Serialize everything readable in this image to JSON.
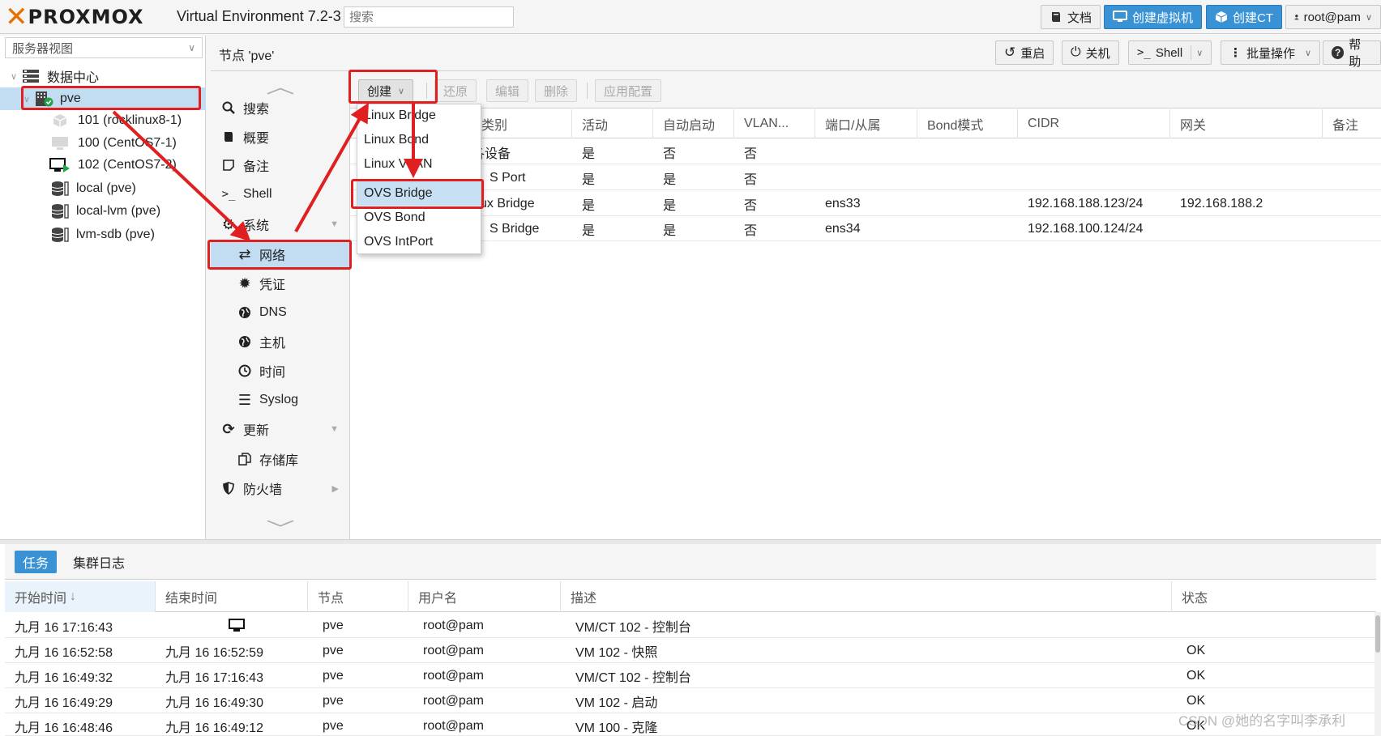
{
  "app": {
    "brand": "PROXMOX",
    "version": "Virtual Environment 7.2-3",
    "search_placeholder": "搜索"
  },
  "topbar": {
    "docs": "文档",
    "create_vm": "创建虚拟机",
    "create_ct": "创建CT",
    "user": "root@pam"
  },
  "tree": {
    "view": "服务器视图",
    "items": [
      {
        "label": "数据中心",
        "icon": "datacenter-icon"
      },
      {
        "label": "pve",
        "icon": "node-online-icon"
      },
      {
        "label": "101 (rocklinux8-1)",
        "icon": "container-icon"
      },
      {
        "label": "100 (CentOS7-1)",
        "icon": "vm-stopped-icon"
      },
      {
        "label": "102 (CentOS7-2)",
        "icon": "vm-running-icon"
      },
      {
        "label": "local (pve)",
        "icon": "storage-icon"
      },
      {
        "label": "local-lvm (pve)",
        "icon": "storage-icon"
      },
      {
        "label": "lvm-sdb (pve)",
        "icon": "storage-icon"
      }
    ]
  },
  "node": {
    "title": "节点 'pve'",
    "reboot": "重启",
    "shutdown": "关机",
    "shell": "Shell",
    "bulk": "批量操作",
    "help": "帮助"
  },
  "nodemenu": {
    "search": "搜索",
    "summary": "概要",
    "notes": "备注",
    "shell": "Shell",
    "system": "系统",
    "network": "网络",
    "certificates": "凭证",
    "dns": "DNS",
    "hosts": "主机",
    "time": "时间",
    "syslog": "Syslog",
    "updates": "更新",
    "repositories": "存储库",
    "firewall": "防火墙"
  },
  "network": {
    "toolbar": {
      "create": "创建",
      "revert": "还原",
      "edit": "编辑",
      "remove": "删除",
      "apply": "应用配置"
    },
    "columns": [
      "类别",
      "活动",
      "自动启动",
      "VLAN...",
      "端口/从属",
      "Bond模式",
      "CIDR",
      "网关",
      "备注"
    ],
    "rows": [
      {
        "type": "网络设备",
        "active": "是",
        "autostart": "否",
        "vlan": "否",
        "ports": "",
        "cidr": "",
        "gateway": ""
      },
      {
        "type": "OVS Port",
        "active": "是",
        "autostart": "是",
        "vlan": "否",
        "ports": "",
        "cidr": "",
        "gateway": ""
      },
      {
        "type": "Linux Bridge",
        "active": "是",
        "autostart": "是",
        "vlan": "否",
        "ports": "ens33",
        "cidr": "192.168.188.123/24",
        "gateway": "192.168.188.2"
      },
      {
        "type": "OVS Bridge",
        "active": "是",
        "autostart": "是",
        "vlan": "否",
        "ports": "ens34",
        "cidr": "192.168.100.124/24",
        "gateway": ""
      }
    ],
    "visible_type_text": [
      "各设备",
      "S Port",
      "ux Bridge",
      "S Bridge"
    ],
    "create_menu": [
      "Linux Bridge",
      "Linux Bond",
      "Linux VLAN",
      "OVS Bridge",
      "OVS Bond",
      "OVS IntPort"
    ]
  },
  "tasks": {
    "tabs": [
      "任务",
      "集群日志"
    ],
    "columns": [
      "开始时间",
      "结束时间",
      "节点",
      "用户名",
      "描述",
      "状态"
    ],
    "rows": [
      {
        "start": "九月 16 17:16:43",
        "end": "",
        "node": "pve",
        "user": "root@pam",
        "desc": "VM/CT 102 - 控制台",
        "status": ""
      },
      {
        "start": "九月 16 16:52:58",
        "end": "九月 16 16:52:59",
        "node": "pve",
        "user": "root@pam",
        "desc": "VM 102 - 快照",
        "status": "OK"
      },
      {
        "start": "九月 16 16:49:32",
        "end": "九月 16 17:16:43",
        "node": "pve",
        "user": "root@pam",
        "desc": "VM/CT 102 - 控制台",
        "status": "OK"
      },
      {
        "start": "九月 16 16:49:29",
        "end": "九月 16 16:49:30",
        "node": "pve",
        "user": "root@pam",
        "desc": "VM 102 - 启动",
        "status": "OK"
      },
      {
        "start": "九月 16 16:48:46",
        "end": "九月 16 16:49:12",
        "node": "pve",
        "user": "root@pam",
        "desc": "VM 100 - 克隆",
        "status": "OK"
      }
    ]
  },
  "watermark": "CSDN @她的名字叫李承利",
  "colors": {
    "accent": "#3892d4",
    "brand_orange": "#e57000",
    "selection": "#c2ddf2",
    "annotation_red": "#e02020"
  }
}
